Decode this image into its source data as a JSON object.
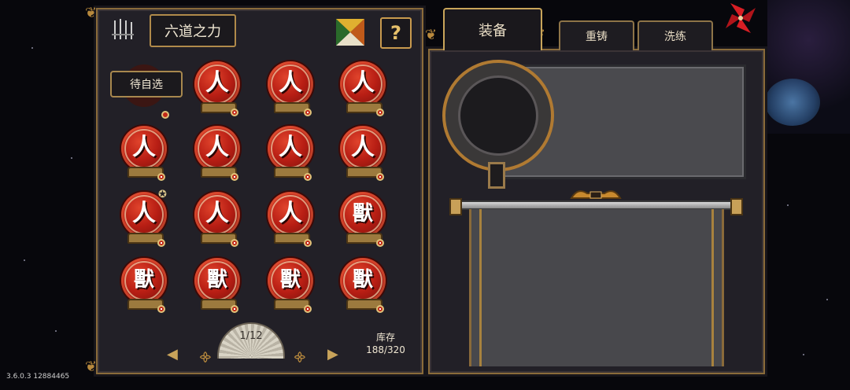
{
  "left_panel": {
    "title": "六道之力",
    "pending_label": "待自选",
    "help_label": "?",
    "page_indicator": "1/12",
    "stock_label": "库存",
    "stock_value": "188/320",
    "grid": [
      [
        "",
        "人",
        "人",
        "人"
      ],
      [
        "人",
        "人",
        "人",
        "人"
      ],
      [
        "人",
        "人",
        "人",
        "獸"
      ],
      [
        "獸",
        "獸",
        "獸",
        "獸"
      ]
    ]
  },
  "right_panel": {
    "tabs": [
      {
        "label": "装备",
        "active": true
      },
      {
        "label": "重铸",
        "active": false
      },
      {
        "label": "洗练",
        "active": false
      }
    ]
  },
  "version_text": "3.6.0.3 12884465",
  "colors": {
    "accent_gold": "#b8893d",
    "orb_red": "#b81e14",
    "panel_bg": "#222027"
  },
  "icons": [
    "spear-rack-icon",
    "puzzle-tangram-icon",
    "help-icon",
    "close-pinwheel-icon",
    "prev-arrow-icon",
    "next-arrow-icon"
  ]
}
